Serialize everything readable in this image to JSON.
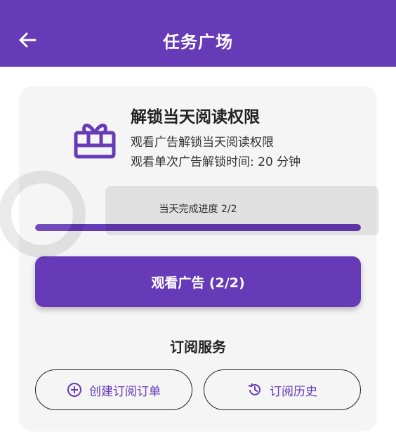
{
  "app_bar": {
    "title": "任务广场",
    "back_icon": "arrow-left-icon",
    "background": "#673ab7"
  },
  "card": {
    "icon": "gift-icon",
    "title": "解锁当天阅读权限",
    "desc_line1": "观看广告解锁当天阅读权限",
    "desc_line2": "观看单次广告解锁时间: 20 分钟",
    "progress_label": "当天完成进度  2/2",
    "progress_value": 1.0,
    "watch_button_label": "观看广告 (2/2)"
  },
  "subscription": {
    "title": "订阅服务",
    "create_order_label": "创建订阅订单",
    "create_order_icon": "add-circle-icon",
    "history_label": "订阅历史",
    "history_icon": "history-icon"
  },
  "colors": {
    "accent": "#673ab7",
    "track": "#e0d8ef",
    "card_bg": "#f5f5f5"
  }
}
